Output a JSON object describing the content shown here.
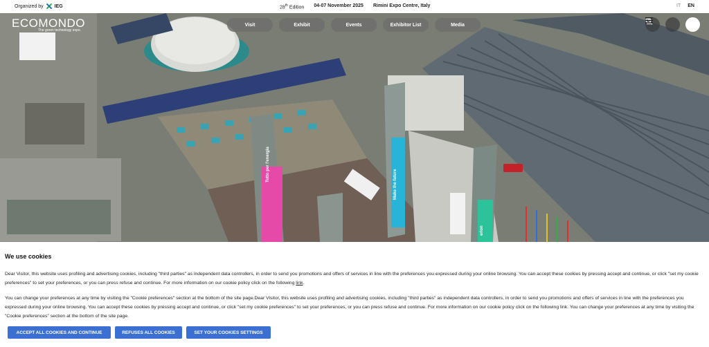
{
  "topbar": {
    "organized_by": "Organized by",
    "organizer": "IEG",
    "edition_num": "28",
    "edition_sup": "th",
    "edition_word": "Edition",
    "dates": "04-07 November 2025",
    "venue": "Rimini Expo Centre, Italy",
    "lang_it": "IT",
    "lang_en": "EN"
  },
  "logo": {
    "name": "ECOMONDO",
    "tagline": "The green technology expo."
  },
  "nav": {
    "items": [
      "Visit",
      "Exhibit",
      "Events",
      "Exhibitor List",
      "Media"
    ]
  },
  "hero": {
    "tower_texts": [
      "Tutto per l'energia",
      "Make the future",
      "erion"
    ]
  },
  "cookie": {
    "title": "We use cookies",
    "p1_text": "Dear Visitor, this website uses profiling and advertising cookies, including \"third parties\" as independent data controllers, in order to send you promotions and offers of services in line with the preferences you expressed during your online browsing. You can accept these cookies by pressing accept and continue, or click \"set my cookie preferences\" to set your preferences, or you can press refuse and continue. For more information on our cookie policy click on the following ",
    "link_label": "link",
    "p1_end": ".",
    "p2_text": "You can change your preferences at any time by visiting the \"Cookie preferences\" section at the bottom of the site page.Dear Visitor, this website uses profiling and advertising cookies, including \"third parties\" as independent data controllers, in order to send you promotions and offers of services in line with the preferences you expressed during your online browsing. You can accept these cookies by pressing accept and continue, or click \"set my cookie preferences\" to set your preferences, or you can press refuse and continue. For more information on our cookie policy click on the following link. You can change your preferences at any time by visiting the \"Cookie preferences\" section at the bottom of the site page.",
    "accept_label": "ACCEPT ALL COOKIES AND CONTINUE",
    "refuse_label": "REFUSES ALL COOKIES",
    "settings_label": "SET YOUR COOKIES SETTINGS"
  },
  "colors": {
    "button_blue": "#3b6fd1",
    "nav_pill": "#6e6e6e"
  },
  "icons": [
    "search-icon",
    "user-icon",
    "menu-icon"
  ]
}
